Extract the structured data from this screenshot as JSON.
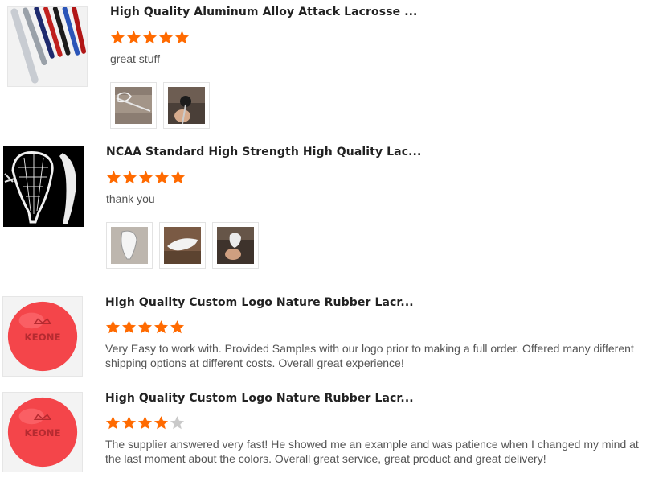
{
  "reviews": [
    {
      "product_title": "High Quality Aluminum Alloy Attack Lacrosse ...",
      "rating": 5,
      "comment": "great stuff",
      "thumbnail_icon": "lacrosse-shafts-image",
      "photos": [
        "lacrosse-stick-photo",
        "lacrosse-stick-hand-photo"
      ]
    },
    {
      "product_title": "NCAA Standard High Strength High Quality Lac...",
      "rating": 5,
      "comment": "thank you",
      "thumbnail_icon": "lacrosse-head-image",
      "photos": [
        "lacrosse-head-photo",
        "lacrosse-head-side-photo",
        "lacrosse-head-hand-photo"
      ]
    },
    {
      "product_title": "High Quality Custom Logo Nature Rubber Lacr...",
      "rating": 5,
      "comment": "Very Easy to work with. Provided Samples with our logo prior to making a full order. Offered many different shipping options at different costs. Overall great experience!",
      "thumbnail_icon": "red-lacrosse-ball-image",
      "photos": []
    },
    {
      "product_title": "High Quality Custom Logo Nature Rubber Lacr...",
      "rating": 4,
      "comment": "The supplier answered very fast! He showed me an example and was patience when I changed my mind at the last moment about the colors. Overall great service, great product and great delivery!",
      "thumbnail_icon": "red-lacrosse-ball-image",
      "photos": []
    }
  ],
  "ball_logo_text": "KEONE",
  "colors": {
    "star_filled": "#ff6a00",
    "star_empty": "#c9c9c9",
    "ball_red": "#f4454a"
  }
}
